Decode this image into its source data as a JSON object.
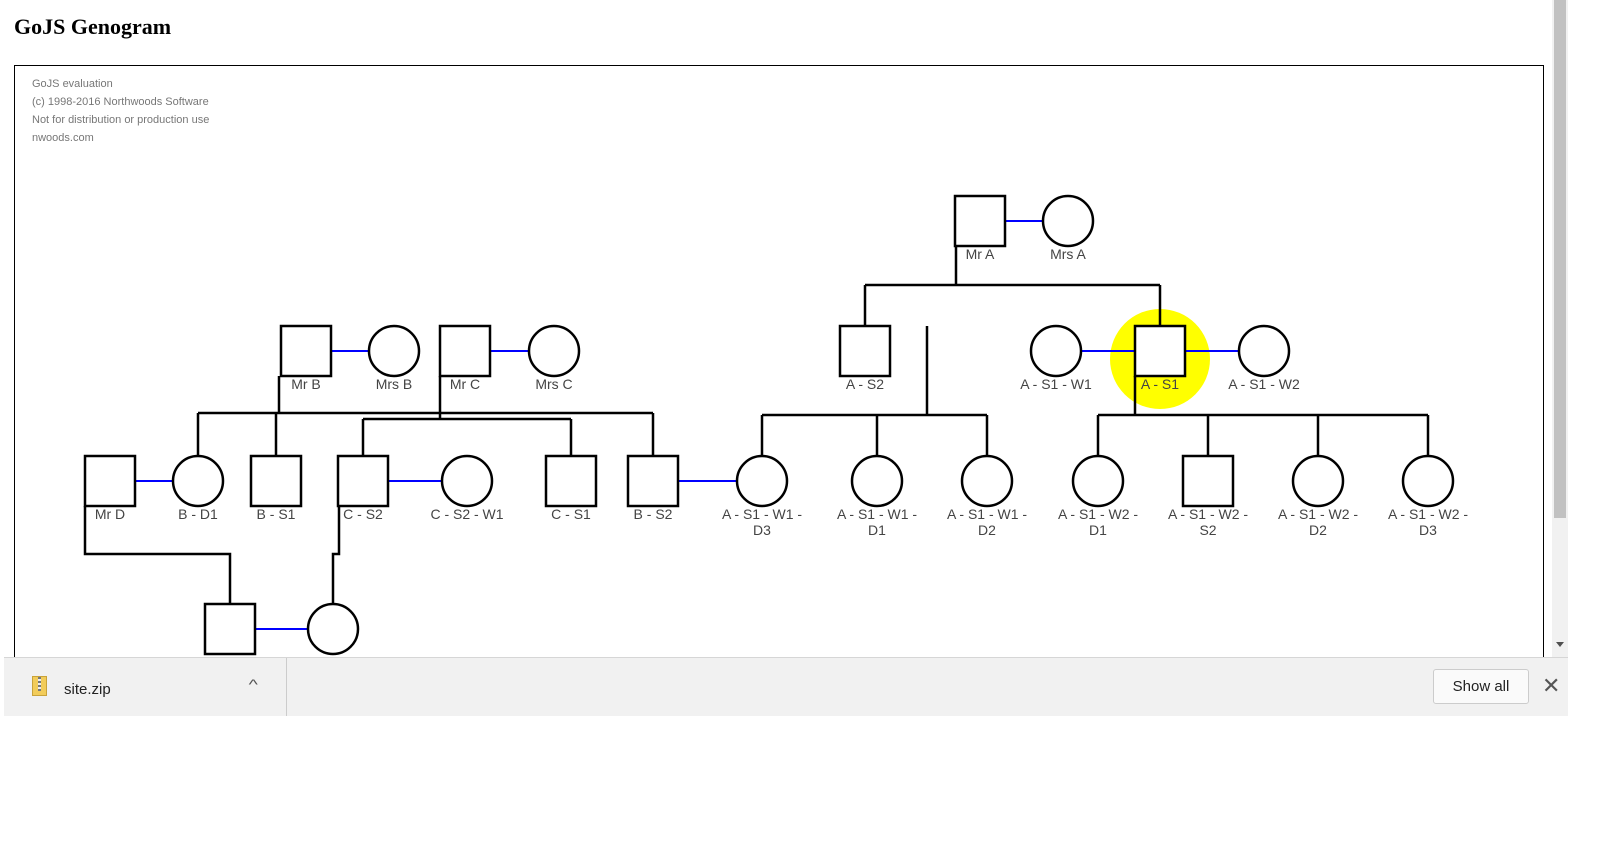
{
  "page_title": "GoJS Genogram",
  "watermark": [
    "GoJS evaluation",
    "(c) 1998-2016 Northwoods Software",
    "Not for distribution or production use",
    "nwoods.com"
  ],
  "colors": {
    "marriage_link": "#0000ff",
    "parent_link": "#000000",
    "highlight": "#ffff00"
  },
  "people": [
    {
      "name": "Mr A",
      "sex": "M"
    },
    {
      "name": "Mrs A",
      "sex": "F"
    },
    {
      "name": "Mr B",
      "sex": "M"
    },
    {
      "name": "Mrs B",
      "sex": "F"
    },
    {
      "name": "Mr C",
      "sex": "M"
    },
    {
      "name": "Mrs C",
      "sex": "F"
    },
    {
      "name": "A - S2",
      "sex": "M"
    },
    {
      "name": "A - S1 - W1",
      "sex": "F"
    },
    {
      "name": "A - S1",
      "sex": "M",
      "highlighted": true
    },
    {
      "name": "A - S1 - W2",
      "sex": "F"
    },
    {
      "name": "Mr D",
      "sex": "M"
    },
    {
      "name": "B - D1",
      "sex": "F"
    },
    {
      "name": "B - S1",
      "sex": "M"
    },
    {
      "name": "C - S2",
      "sex": "M"
    },
    {
      "name": "C - S2 - W1",
      "sex": "F"
    },
    {
      "name": "C - S1",
      "sex": "M"
    },
    {
      "name": "B - S2",
      "sex": "M"
    },
    {
      "name": "A - S1 - W1 -\nD3",
      "sex": "F"
    },
    {
      "name": "A - S1 - W1 -\nD1",
      "sex": "F"
    },
    {
      "name": "A - S1 - W1 -\nD2",
      "sex": "F"
    },
    {
      "name": "A - S1 - W2 -\nD1",
      "sex": "F"
    },
    {
      "name": "A - S1 - W2 -\nS2",
      "sex": "M"
    },
    {
      "name": "A - S1 - W2 -\nD2",
      "sex": "F"
    },
    {
      "name": "A - S1 - W2 -\nD3",
      "sex": "F"
    },
    {
      "name": "",
      "sex": "M"
    },
    {
      "name": "",
      "sex": "F"
    }
  ],
  "download_bar": {
    "file_name": "site.zip",
    "show_all_label": "Show all",
    "close_icon": "close-icon",
    "chevron_icon": "chevron-up-icon",
    "file_icon": "zip-file-icon"
  }
}
